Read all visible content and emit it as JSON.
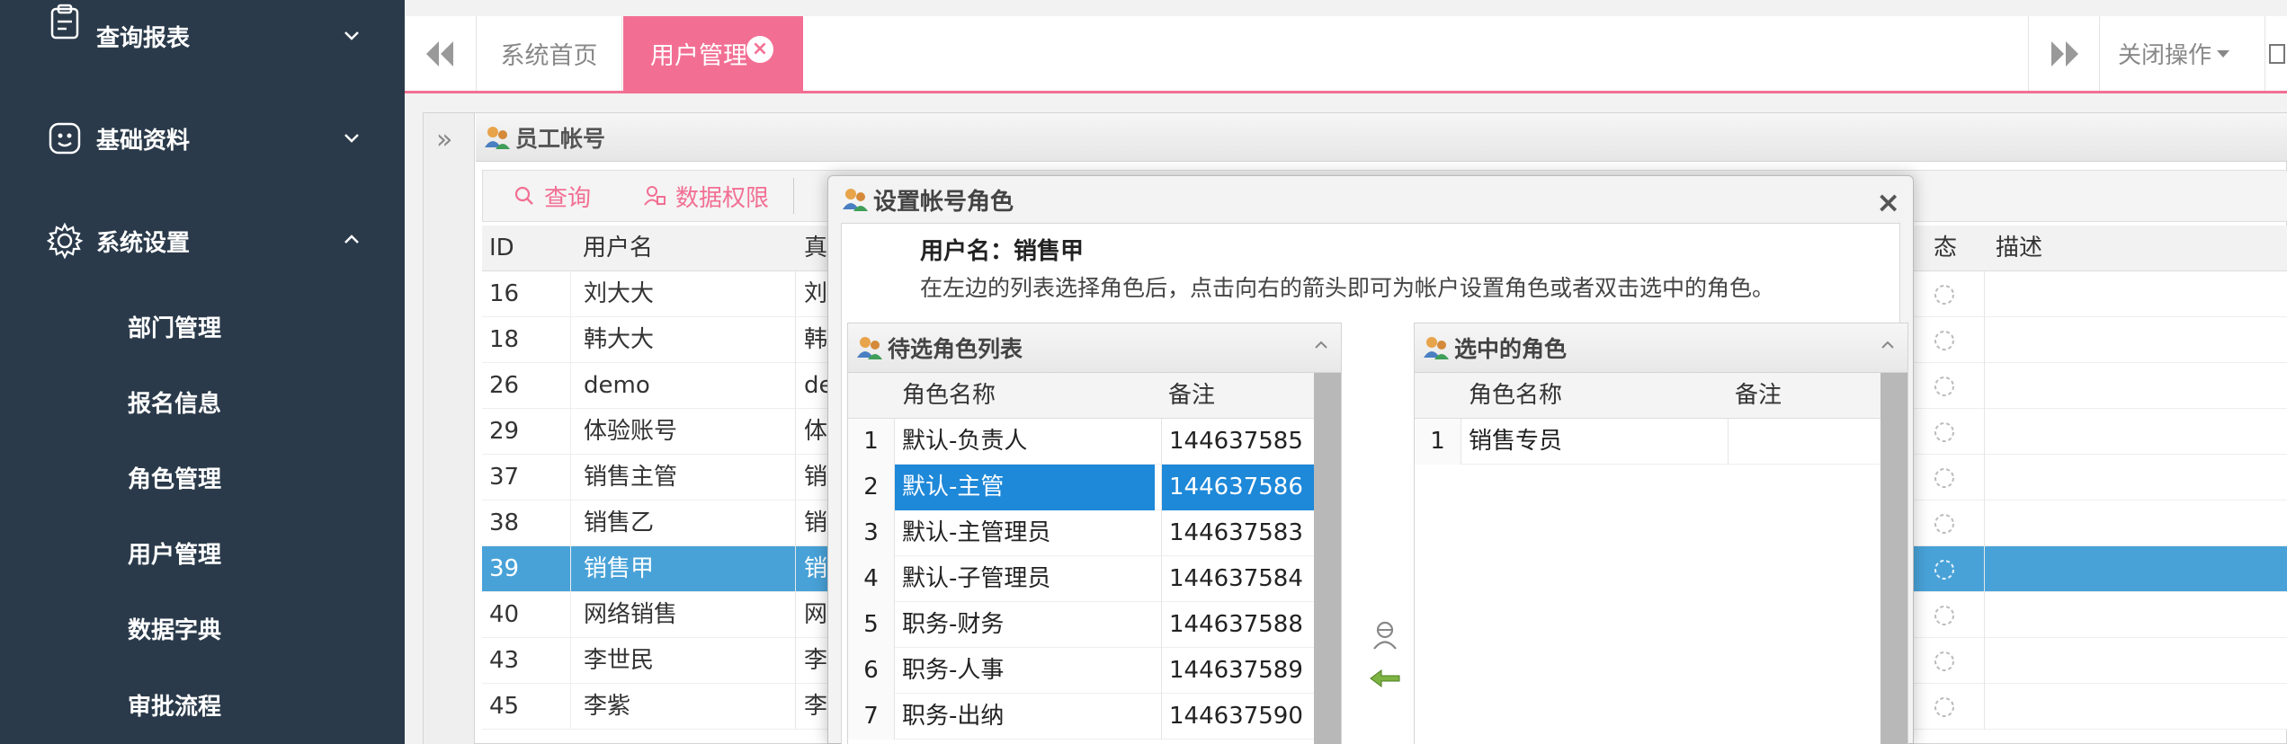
{
  "sidebar": {
    "groups": [
      {
        "label": "查询报表",
        "icon": "report-icon",
        "expanded": false
      },
      {
        "label": "基础资料",
        "icon": "basic-data-icon",
        "expanded": false
      },
      {
        "label": "系统设置",
        "icon": "settings-gear-icon",
        "expanded": true
      }
    ],
    "sub_items": [
      "部门管理",
      "报名信息",
      "角色管理",
      "用户管理",
      "数据字典",
      "审批流程"
    ]
  },
  "tabs": {
    "home": "系统首页",
    "active": "用户管理",
    "close_ops": "关闭操作"
  },
  "panel": {
    "title": "员工帐号",
    "toolbar": {
      "query": "查询",
      "data_perm": "数据权限"
    },
    "columns": {
      "id": "ID",
      "username": "用户名",
      "realname": "真",
      "status": "态",
      "desc": "描述"
    },
    "rows": [
      {
        "id": "16",
        "username": "刘大大",
        "real": "刘"
      },
      {
        "id": "18",
        "username": "韩大大",
        "real": "韩"
      },
      {
        "id": "26",
        "username": "demo",
        "real": "de"
      },
      {
        "id": "29",
        "username": "体验账号",
        "real": "体"
      },
      {
        "id": "37",
        "username": "销售主管",
        "real": "销"
      },
      {
        "id": "38",
        "username": "销售乙",
        "real": "销"
      },
      {
        "id": "39",
        "username": "销售甲",
        "real": "销",
        "selected": true
      },
      {
        "id": "40",
        "username": "网络销售",
        "real": "网"
      },
      {
        "id": "43",
        "username": "李世民",
        "real": "李"
      },
      {
        "id": "45",
        "username": "李紫",
        "real": "李"
      }
    ]
  },
  "dialog": {
    "title": "设置帐号角色",
    "user_line": "用户名：销售甲",
    "tip": "在左边的列表选择角色后，点击向右的箭头即可为帐户设置角色或者双击选中的角色。",
    "left": {
      "title": "待选角色列表",
      "col_name": "角色名称",
      "col_note": "备注",
      "rows": [
        {
          "n": "1",
          "name": "默认-负责人",
          "note": "144637585"
        },
        {
          "n": "2",
          "name": "默认-主管",
          "note": "144637586",
          "selected": true
        },
        {
          "n": "3",
          "name": "默认-主管理员",
          "note": "144637583"
        },
        {
          "n": "4",
          "name": "默认-子管理员",
          "note": "144637584"
        },
        {
          "n": "5",
          "name": "职务-财务",
          "note": "144637588"
        },
        {
          "n": "6",
          "name": "职务-人事",
          "note": "144637589"
        },
        {
          "n": "7",
          "name": "职务-出纳",
          "note": "144637590"
        }
      ]
    },
    "right": {
      "title": "选中的角色",
      "col_name": "角色名称",
      "col_note": "备注",
      "rows": [
        {
          "n": "1",
          "name": "销售专员",
          "note": ""
        }
      ]
    }
  },
  "colors": {
    "sidebar_bg": "#2a3a4a",
    "accent_pink": "#f26f93",
    "row_selected": "#48a2d8",
    "dialog_selected": "#1e88d9"
  }
}
